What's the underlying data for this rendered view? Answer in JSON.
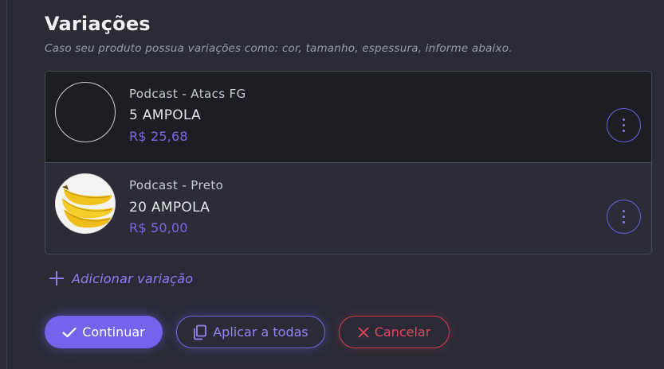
{
  "section": {
    "title": "Variações",
    "subtitle": "Caso seu produto possua variações como: cor, tamanho, espessura, informe abaixo."
  },
  "variations": [
    {
      "name": "Podcast - Atacs FG",
      "quantity": "5 AMPOLA",
      "price": "R$ 25,68",
      "thumbnail": "empty-circle"
    },
    {
      "name": "Podcast - Preto",
      "quantity": "20 AMPOLA",
      "price": "R$ 50,00",
      "thumbnail": "banana-image"
    }
  ],
  "add_variation": {
    "label": "Adicionar variação",
    "icon": "plus-icon"
  },
  "actions": {
    "continue_label": "Continuar",
    "apply_all_label": "Aplicar a todas",
    "cancel_label": "Cancelar"
  },
  "colors": {
    "background": "#2a2b37",
    "accent": "#7563ee",
    "price": "#7c66e6",
    "danger": "#d33a4d"
  }
}
